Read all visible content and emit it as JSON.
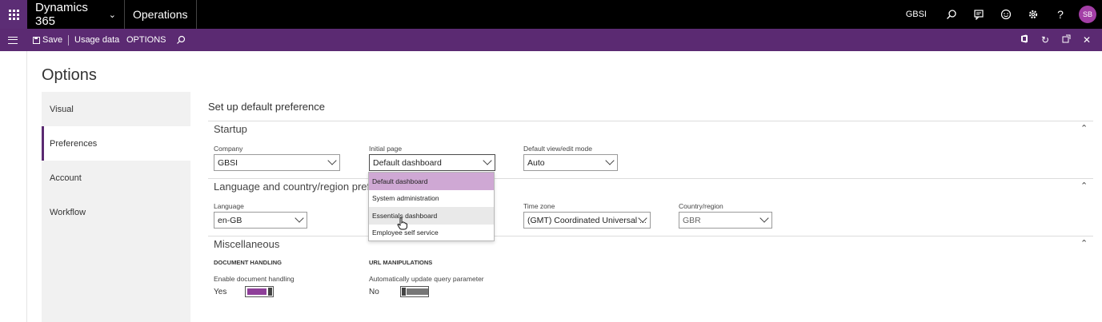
{
  "topbar": {
    "app_name": "Dynamics 365",
    "module": "Operations",
    "company": "GBSI",
    "user_initials": "SB"
  },
  "actionbar": {
    "save_label": "Save",
    "usage_label": "Usage data",
    "options_label": "OPTIONS"
  },
  "page": {
    "title": "Options"
  },
  "tabs": [
    {
      "label": "Visual"
    },
    {
      "label": "Preferences"
    },
    {
      "label": "Account"
    },
    {
      "label": "Workflow"
    }
  ],
  "content": {
    "heading": "Set up default preference",
    "startup": {
      "title": "Startup",
      "company_label": "Company",
      "company_value": "GBSI",
      "initial_page_label": "Initial page",
      "initial_page_value": "Default dashboard",
      "view_mode_label": "Default view/edit mode",
      "view_mode_value": "Auto"
    },
    "language": {
      "title": "Language and country/region prefe",
      "language_label": "Language",
      "language_value": "en-GB",
      "timezone_label": "Time zone",
      "timezone_value": "(GMT) Coordinated Universal ...",
      "country_label": "Country/region",
      "country_value": "GBR"
    },
    "misc": {
      "title": "Miscellaneous",
      "doc_heading": "DOCUMENT HANDLING",
      "doc_label": "Enable document handling",
      "doc_value": "Yes",
      "url_heading": "URL MANIPULATIONS",
      "url_label": "Automatically update query parameter",
      "url_value": "No"
    }
  },
  "dropdown": {
    "items": [
      {
        "label": "Default dashboard"
      },
      {
        "label": "System administration"
      },
      {
        "label": "Essentials dashboard"
      },
      {
        "label": "Employee self service"
      }
    ]
  },
  "colors": {
    "brand_purple": "#5b2a72",
    "selected_item": "#cfa8d4",
    "toggle_on": "#8e3f99"
  }
}
